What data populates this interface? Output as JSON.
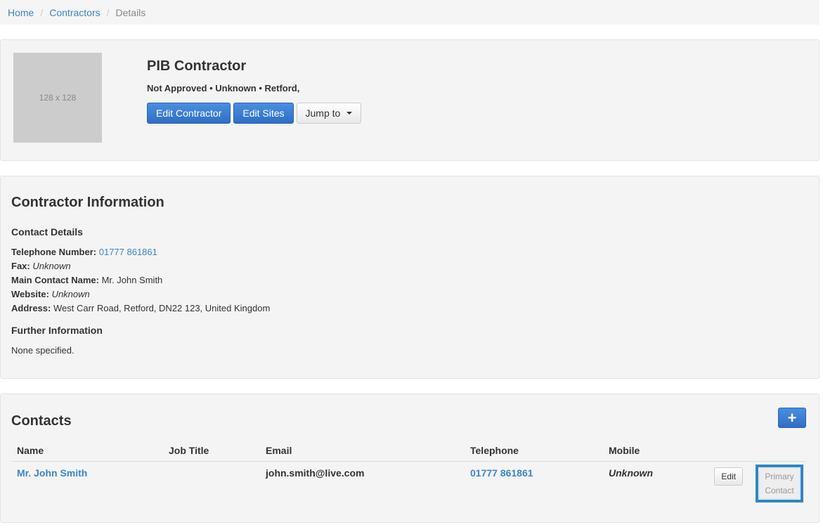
{
  "breadcrumb": {
    "home": "Home",
    "contractors": "Contractors",
    "current": "Details",
    "separator": "/"
  },
  "header": {
    "image_placeholder": "128 x 128",
    "name": "PIB Contractor",
    "status_line": "Not Approved • Unknown • Retford,",
    "edit_contractor_label": "Edit Contractor",
    "edit_sites_label": "Edit Sites",
    "jump_to_label": "Jump to"
  },
  "info": {
    "title": "Contractor Information",
    "contact_details_title": "Contact Details",
    "telephone_label": "Telephone Number:",
    "telephone_value": "01777 861861",
    "fax_label": "Fax:",
    "fax_value": "Unknown",
    "main_contact_label": "Main Contact Name:",
    "main_contact_value": "Mr. John Smith",
    "website_label": "Website:",
    "website_value": "Unknown",
    "address_label": "Address:",
    "address_value": "West Carr Road, Retford, DN22 123, United Kingdom",
    "further_info_title": "Further Information",
    "further_info_value": "None specified."
  },
  "contacts": {
    "title": "Contacts",
    "add_label": "+",
    "columns": {
      "name": "Name",
      "job_title": "Job Title",
      "email": "Email",
      "telephone": "Telephone",
      "mobile": "Mobile"
    },
    "rows": [
      {
        "name": "Mr. John Smith",
        "job_title": "",
        "email": "john.smith@live.com",
        "telephone": "01777 861861",
        "mobile": "Unknown",
        "edit_label": "Edit",
        "primary_label_1": "Primary",
        "primary_label_2": "Contact"
      }
    ]
  },
  "colors": {
    "primary": "#2f6fc6",
    "link": "#3a87c8",
    "highlight": "#2e87c3"
  }
}
